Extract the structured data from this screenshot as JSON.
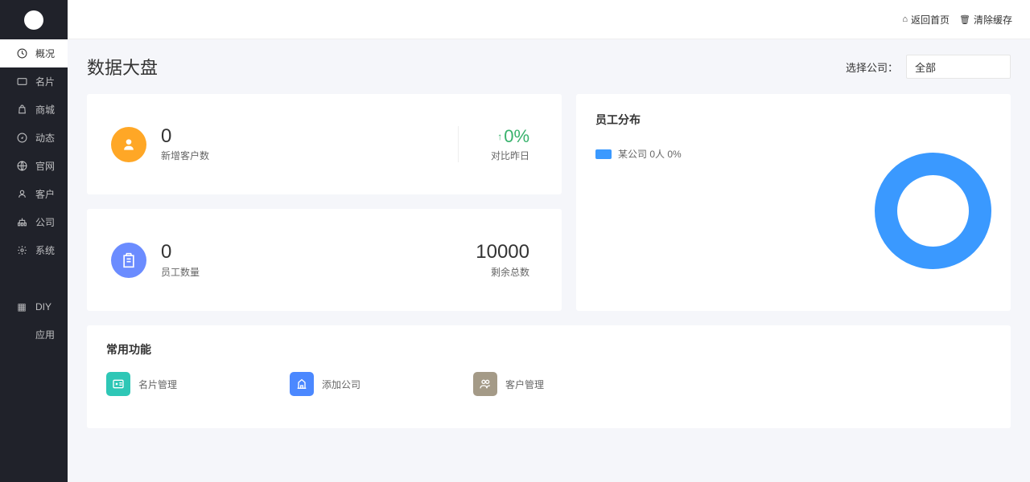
{
  "sidebar": {
    "items": [
      {
        "label": "概况",
        "icon": "clock"
      },
      {
        "label": "名片",
        "icon": "card"
      },
      {
        "label": "商城",
        "icon": "bag"
      },
      {
        "label": "动态",
        "icon": "compass"
      },
      {
        "label": "官网",
        "icon": "globe"
      },
      {
        "label": "客户",
        "icon": "user"
      },
      {
        "label": "公司",
        "icon": "org"
      },
      {
        "label": "系统",
        "icon": "gear"
      }
    ],
    "bottom": [
      {
        "label": "DIY"
      },
      {
        "label": "应用"
      }
    ]
  },
  "header": {
    "home": "返回首页",
    "clear": "清除缓存"
  },
  "page": {
    "title": "数据大盘",
    "companyLabel": "选择公司：",
    "companySelected": "全部"
  },
  "stats": {
    "newCustomers": {
      "value": "0",
      "label": "新增客户数",
      "pct": "0%",
      "pctLabel": "对比昨日"
    },
    "employees": {
      "value": "0",
      "label": "员工数量",
      "remaining": "10000",
      "remainingLabel": "剩余总数"
    }
  },
  "distribution": {
    "title": "员工分布",
    "legend": "某公司  0人  0%"
  },
  "functions": {
    "title": "常用功能",
    "items": [
      {
        "label": "名片管理"
      },
      {
        "label": "添加公司"
      },
      {
        "label": "客户管理"
      }
    ]
  },
  "chart_data": {
    "type": "pie",
    "title": "员工分布",
    "series": [
      {
        "name": "某公司",
        "value": 0,
        "people": 0,
        "percent": 0,
        "color": "#3a99ff"
      }
    ]
  }
}
